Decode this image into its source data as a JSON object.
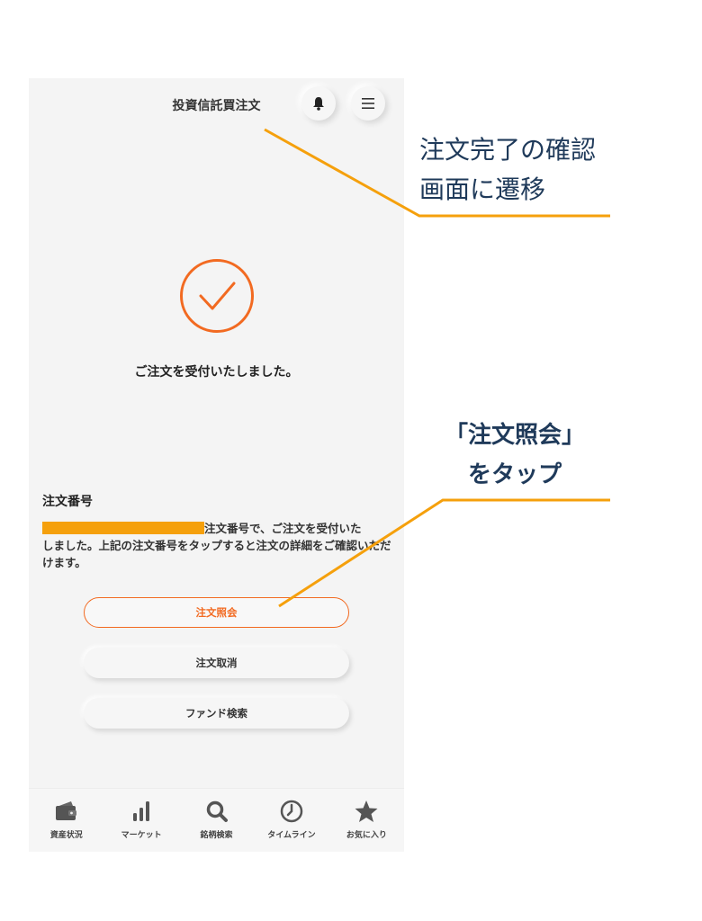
{
  "header": {
    "title": "投資信託買注文"
  },
  "confirmation": {
    "message": "ご注文を受付いたしました。"
  },
  "order": {
    "label": "注文番号",
    "description_line1_suffix": "注文番号で、ご注文を受付いた",
    "description_rest": "しました。上記の注文番号をタップすると注文の詳細をご確認いただけます。"
  },
  "buttons": {
    "inquiry": "注文照会",
    "cancel": "注文取消",
    "fund_search": "ファンド検索"
  },
  "tabbar": {
    "items": [
      {
        "label": "資産状況",
        "icon": "wallet-icon"
      },
      {
        "label": "マーケット",
        "icon": "bar-chart-icon"
      },
      {
        "label": "銘柄検索",
        "icon": "search-icon"
      },
      {
        "label": "タイムライン",
        "icon": "clock-icon"
      },
      {
        "label": "お気に入り",
        "icon": "star-icon"
      }
    ]
  },
  "annotations": {
    "transition_line1": "注文完了の確認",
    "transition_line2": "画面に遷移",
    "tap_line1": "「注文照会」",
    "tap_line2": "をタップ"
  },
  "colors": {
    "accent": "#f26a21",
    "annotation_line": "#f5a00c",
    "annotation_text": "#1f3a5a"
  }
}
